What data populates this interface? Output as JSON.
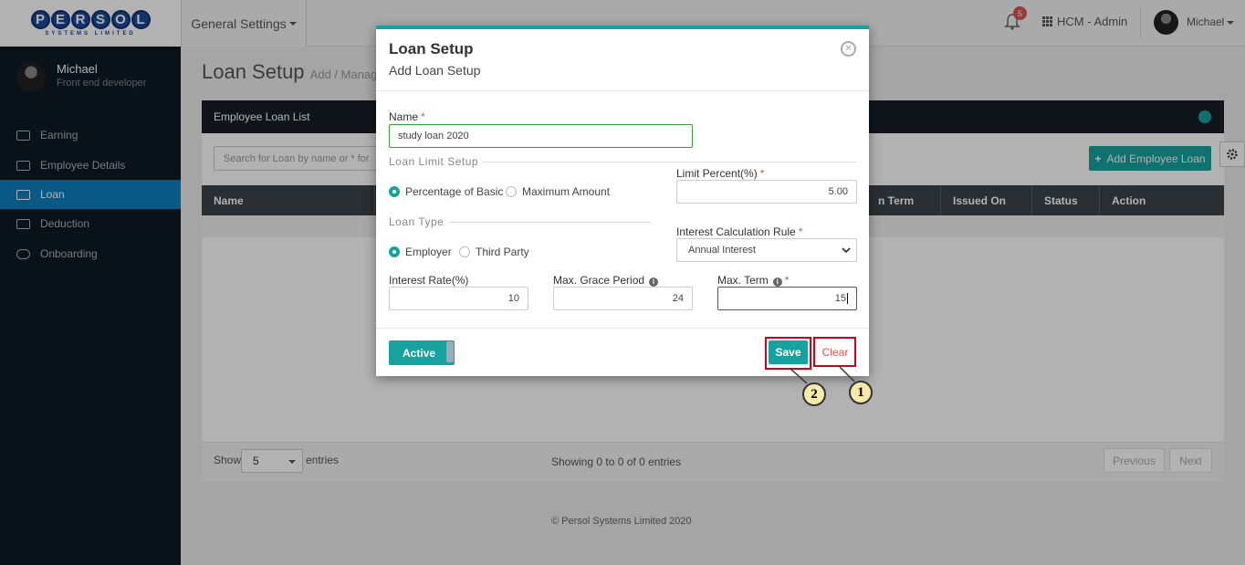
{
  "header": {
    "logo_text": "PERSOL",
    "logo_sub": "SYSTEMS LIMITED",
    "menu_label": "General Settings",
    "notification_count": "5",
    "module_label": "HCM - Admin",
    "user_name": "Michael"
  },
  "sidebar": {
    "user_name": "Michael",
    "user_role": "Front end developer",
    "items": [
      {
        "label": "Earning",
        "icon": "money-icon"
      },
      {
        "label": "Employee Details",
        "icon": "id-card-icon"
      },
      {
        "label": "Loan",
        "icon": "money-icon",
        "active": true
      },
      {
        "label": "Deduction",
        "icon": "minus-square-icon"
      },
      {
        "label": "Onboarding",
        "icon": "cloud-upload-icon"
      }
    ]
  },
  "page": {
    "title": "Loan Setup",
    "subtitle": "Add / Manag",
    "panel_title": "Employee Loan List",
    "search_placeholder": "Search for Loan by name or * for",
    "add_button": "Add Employee Loan",
    "columns": [
      "Name",
      "n Term",
      "Issued On",
      "Status",
      "Action"
    ],
    "show_label": "Show",
    "page_length": "5",
    "entries_label": "entries",
    "info": "Showing 0 to 0 of 0 entries",
    "prev": "Previous",
    "next": "Next",
    "footer": "© Persol Systems Limited 2020"
  },
  "modal": {
    "title": "Loan Setup",
    "subtitle": "Add Loan Setup",
    "name_label": "Name",
    "name_value": "study loan 2020",
    "loan_limit_legend": "Loan Limit Setup",
    "limit_options": [
      "Percentage of Basic",
      "Maximum Amount"
    ],
    "limit_selected": "Percentage of Basic",
    "limit_percent_label": "Limit Percent(%)",
    "limit_percent_value": "5.00",
    "loan_type_legend": "Loan Type",
    "type_options": [
      "Employer",
      "Third Party"
    ],
    "type_selected": "Employer",
    "interest_rule_label": "Interest Calculation Rule",
    "interest_rule_value": "Annual Interest",
    "interest_rate_label": "Interest Rate(%)",
    "interest_rate_value": "10",
    "grace_label": "Max. Grace Period",
    "grace_value": "24",
    "term_label": "Max. Term",
    "term_value": "15",
    "active_label": "Active",
    "save_label": "Save",
    "clear_label": "Clear"
  },
  "annotations": {
    "callout_1": "1",
    "callout_2": "2",
    "highlight_color": "#d0021b"
  },
  "colors": {
    "accent": "#17a2a0",
    "sidebar_bg": "#0d1a24",
    "active_nav": "#0e7fbf",
    "danger": "#d9534f"
  }
}
